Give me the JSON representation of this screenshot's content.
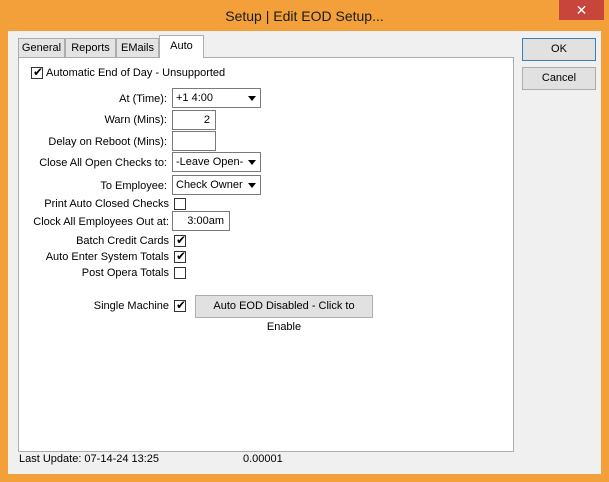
{
  "window": {
    "title": "Setup | Edit EOD Setup...",
    "close_glyph": "✕"
  },
  "tabs": [
    "General",
    "Reports",
    "EMails",
    "Auto"
  ],
  "auto": {
    "automatic_eod_label": "Automatic End of Day - Unsupported",
    "at_time_label": "At (Time):",
    "at_time_value": "+1 4:00",
    "warn_label": "Warn (Mins):",
    "warn_value": "2",
    "delay_label": "Delay on Reboot (Mins):",
    "delay_value": "",
    "close_checks_label": "Close All Open Checks to:",
    "close_checks_value": "-Leave Open-",
    "to_employee_label": "To Employee:",
    "to_employee_value": "Check Owner",
    "print_auto_closed_label": "Print Auto Closed Checks",
    "clock_out_label": "Clock All Employees Out at:",
    "clock_out_value": "3:00am",
    "batch_credit_label": "Batch Credit Cards",
    "auto_enter_label": "Auto Enter System Totals",
    "post_opera_label": "Post Opera Totals",
    "single_machine_label": "Single Machine",
    "auto_eod_button": "Auto EOD Disabled - Click to Enable"
  },
  "checks": {
    "automatic_eod": true,
    "print_auto_closed": false,
    "batch_credit": true,
    "auto_enter": true,
    "post_opera": false,
    "single_machine": true
  },
  "buttons": {
    "ok": "OK",
    "cancel": "Cancel"
  },
  "status": {
    "last_update": "Last Update: 07-14-24 13:25",
    "version": "0.00001"
  }
}
